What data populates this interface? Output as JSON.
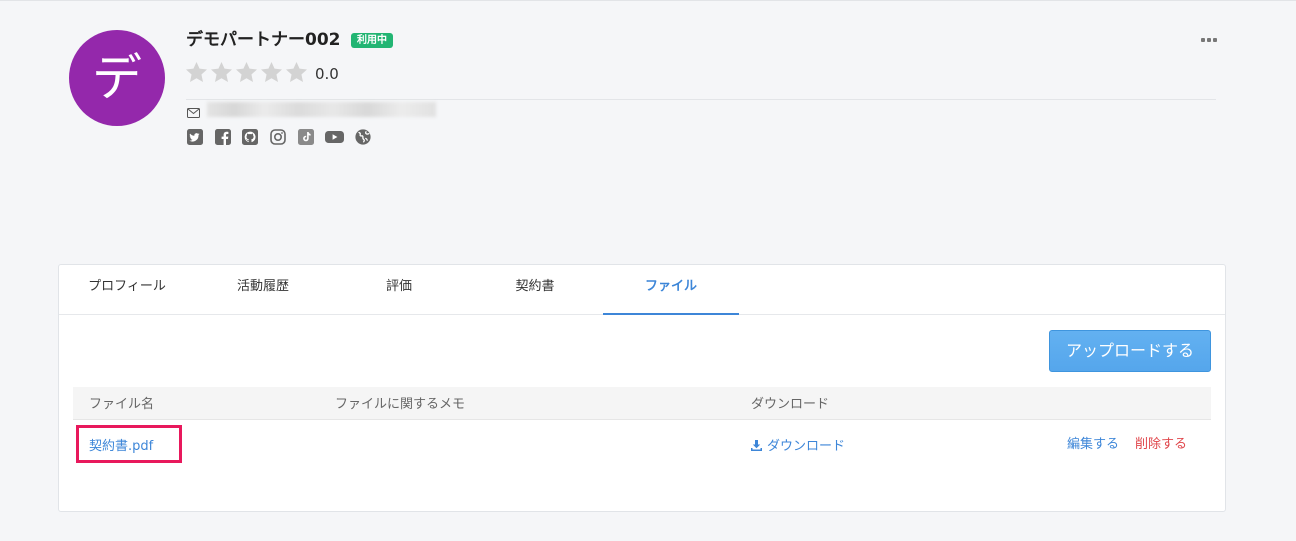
{
  "profile": {
    "avatar_initial": "デ",
    "name": "デモパートナー002",
    "status_badge": "利用中",
    "rating_text": "0.0",
    "rating_value": 0,
    "rating_max": 5,
    "contact_icon": "envelope-icon",
    "social_icons": [
      "twitter-icon",
      "facebook-icon",
      "github-icon",
      "instagram-icon",
      "tiktok-icon",
      "youtube-icon",
      "globe-icon"
    ]
  },
  "header_menu_icon": "more-options-icon",
  "tabs": [
    {
      "label": "プロフィール",
      "active": false
    },
    {
      "label": "活動履歴",
      "active": false
    },
    {
      "label": "評価",
      "active": false
    },
    {
      "label": "契約書",
      "active": false
    },
    {
      "label": "ファイル",
      "active": true
    }
  ],
  "files": {
    "upload_label": "アップロードする",
    "columns": [
      "ファイル名",
      "ファイルに関するメモ",
      "ダウンロード"
    ],
    "rows": [
      {
        "file_name": "契約書.pdf",
        "download_icon": "download-icon",
        "download_label": "ダウンロード",
        "edit_label": "編集する",
        "delete_label": "削除する"
      }
    ]
  },
  "colors": {
    "page_bg": "#f5f6f8",
    "avatar": "#9428ab",
    "status_badge": "#22b573",
    "star_empty": "#d3d3d3",
    "accent": "#3d86d8",
    "button": "#55a6ec",
    "danger": "#e0464b",
    "highlight": "#e8185c"
  }
}
